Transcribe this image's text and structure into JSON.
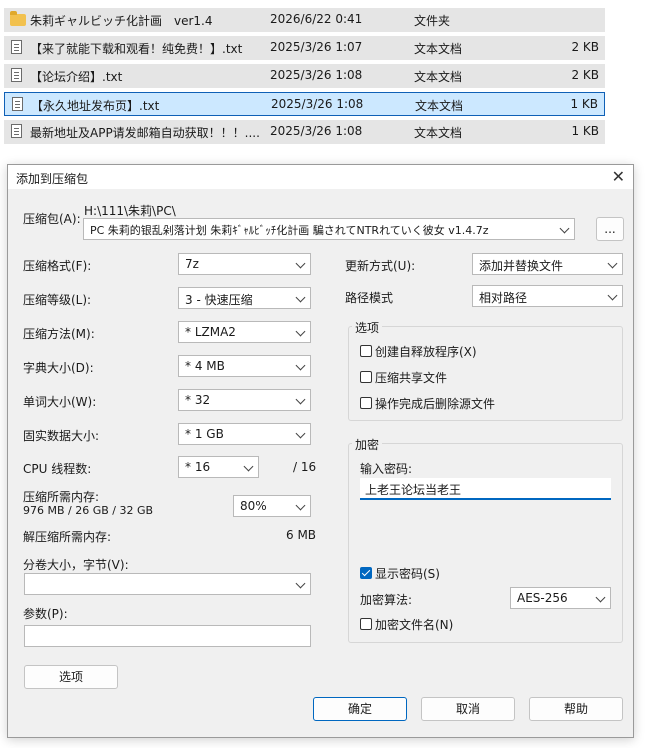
{
  "files": [
    {
      "name": "朱莉ギャルビッチ化計画　ver1.4",
      "date": "2026/6/22 0:41",
      "type": "文件夹",
      "size": "",
      "kind": "folder"
    },
    {
      "name": "【来了就能下载和观看！纯免费！】.txt",
      "date": "2025/3/26 1:07",
      "type": "文本文档",
      "size": "2 KB",
      "kind": "txt"
    },
    {
      "name": "【论坛介绍】.txt",
      "date": "2025/3/26 1:08",
      "type": "文本文档",
      "size": "2 KB",
      "kind": "txt"
    },
    {
      "name": "【永久地址发布页】.txt",
      "date": "2025/3/26 1:08",
      "type": "文本文档",
      "size": "1 KB",
      "kind": "txt",
      "selected": true
    },
    {
      "name": "最新地址及APP请发邮箱自动获取！！！....",
      "date": "2025/3/26 1:08",
      "type": "文本文档",
      "size": "1 KB",
      "kind": "txt"
    }
  ],
  "dialog": {
    "title": "添加到压缩包",
    "close_icon": "close-icon",
    "archive_label": "压缩包(A):",
    "archive_path": "H:\\111\\朱莉\\PC\\",
    "archive_name": "PC 朱莉的银乱剁落计划 朱莉ｷﾞｬﾙﾋﾞｯﾁ化計画 騙されてNTRれていく彼女 v1.4.7z",
    "browse_label": "...",
    "format_label": "压缩格式(F):",
    "format_value": "7z",
    "level_label": "压缩等级(L):",
    "level_value": "3 - 快速压缩",
    "method_label": "压缩方法(M):",
    "method_value": "*  LZMA2",
    "dict_label": "字典大小(D):",
    "dict_value": "*  4 MB",
    "word_label": "单词大小(W):",
    "word_value": "*  32",
    "solid_label": "固实数据大小:",
    "solid_value": "*  1 GB",
    "cpu_label": "CPU 线程数:",
    "cpu_value": "*  16",
    "cpu_total": "/ 16",
    "mem_label": "压缩所需内存:",
    "mem_value": "976 MB / 26 GB / 32 GB",
    "mem_percent": "80%",
    "decomp_label": "解压缩所需内存:",
    "decomp_value": "6 MB",
    "split_label": "分卷大小，字节(V):",
    "split_value": "",
    "params_label": "参数(P):",
    "params_value": "",
    "options_button": "选项",
    "update_label": "更新方式(U):",
    "update_value": "添加并替换文件",
    "path_label": "路径模式",
    "path_value": "相对路径",
    "options_group": "选项",
    "opt_sfx": "创建自释放程序(X)",
    "opt_shared": "压缩共享文件",
    "opt_delete": "操作完成后删除源文件",
    "enc_group": "加密",
    "pwd_label": "输入密码:",
    "pwd_value": "上老王论坛当老王",
    "show_pwd": "显示密码(S)",
    "show_pwd_checked": true,
    "enc_method_label": "加密算法:",
    "enc_method_value": "AES-256",
    "enc_names": "加密文件名(N)",
    "ok_button": "确定",
    "cancel_button": "取消",
    "help_button": "帮助"
  }
}
